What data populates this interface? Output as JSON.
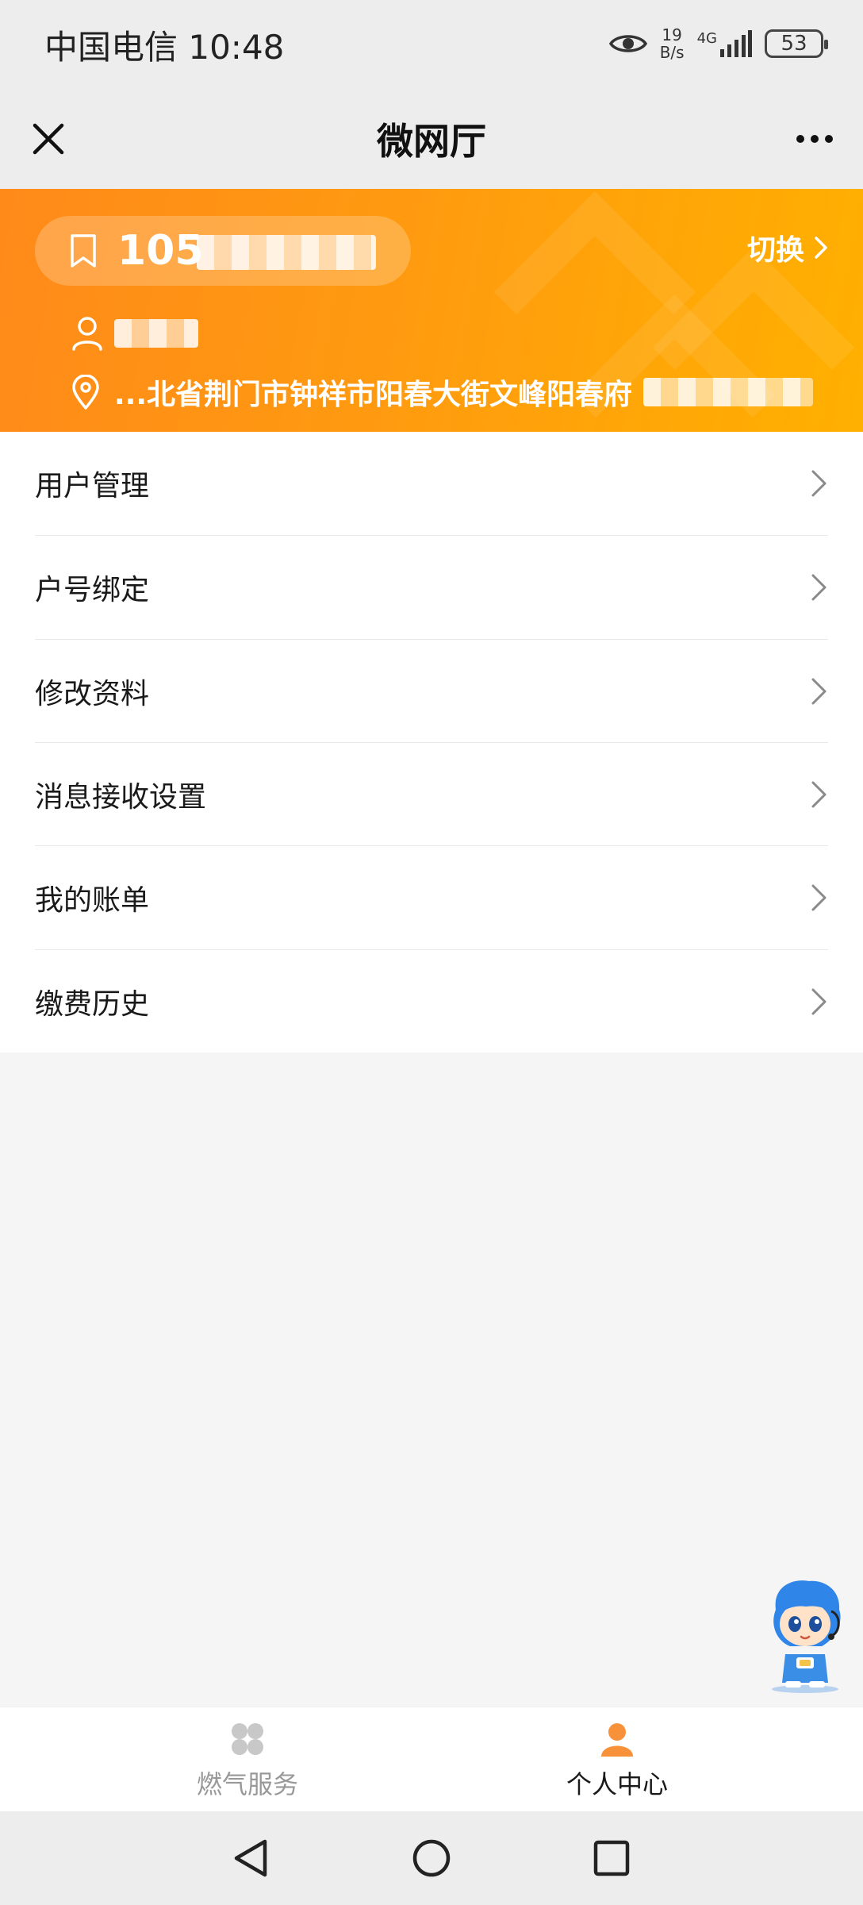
{
  "status_bar": {
    "carrier_time": "中国电信 10:48",
    "speed_value": "19",
    "speed_unit": "B/s",
    "network": "4G",
    "battery": "53"
  },
  "nav": {
    "title": "微网厅"
  },
  "account": {
    "number_visible": "105",
    "switch_label": "切换",
    "address": "...北省荆门市钟祥市阳春大街文峰阳春府"
  },
  "menu": {
    "items": [
      {
        "label": "用户管理"
      },
      {
        "label": "户号绑定"
      },
      {
        "label": "修改资料"
      },
      {
        "label": "消息接收设置"
      },
      {
        "label": "我的账单"
      },
      {
        "label": "缴费历史"
      }
    ]
  },
  "tabs": [
    {
      "label": "燃气服务",
      "active": false
    },
    {
      "label": "个人中心",
      "active": true
    }
  ],
  "colors": {
    "accent": "#ff9a10",
    "tab_active": "#1a1a1a",
    "tab_inactive": "#999999",
    "icon_active": "#f7923a",
    "icon_inactive": "#c8c8c8"
  }
}
